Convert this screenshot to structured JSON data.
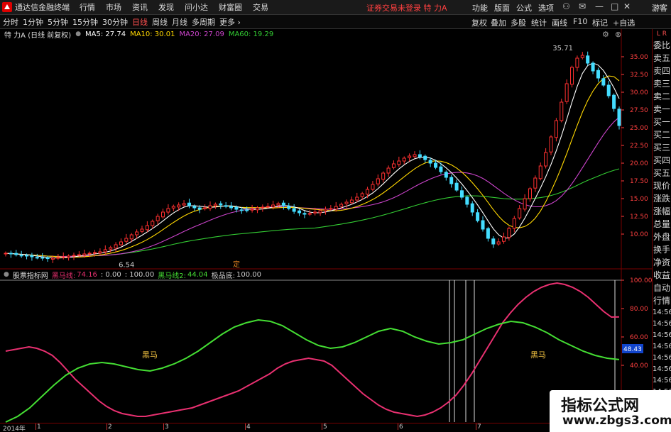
{
  "topbar": {
    "app_title": "通达信金融终端",
    "menus": [
      "行情",
      "市场",
      "资讯",
      "发现",
      "问小达",
      "财富圈",
      "交易"
    ],
    "login_status": "证券交易未登录",
    "stock_name": "特 力A",
    "right_menus": [
      "功能",
      "版面",
      "公式",
      "选项"
    ],
    "guest": "游客"
  },
  "toolbar": {
    "periods": [
      "分时",
      "1分钟",
      "5分钟",
      "15分钟",
      "30分钟",
      "日线",
      "周线",
      "月线",
      "多周期",
      "更多 ›"
    ],
    "active_period": "日线",
    "tools": [
      "复权",
      "叠加",
      "多股",
      "统计",
      "画线",
      "F10",
      "标记",
      "+自选"
    ]
  },
  "infobar": {
    "title": "特 力A (日线 前复权)",
    "ma5": "MA5: 27.74",
    "ma10": "MA10: 30.01",
    "ma20": "MA20: 27.09",
    "ma60": "MA60: 19.29"
  },
  "subinfo": {
    "indicator": "股票指标网",
    "line1_label": "黑马线:",
    "line1_value": "74.16",
    "zero": ": 0.00",
    "hundred": ": 100.00",
    "line2_label": "黑马线2:",
    "line2_value": "44.04",
    "bottom_label": "极品底:",
    "bottom_value": "100.00"
  },
  "annotations": {
    "high": "35.71",
    "low": "6.54",
    "marker_hm1": "黑马",
    "marker_hm2": "黑马",
    "marker_d": "定",
    "current_tag": "48.43"
  },
  "right_panel": {
    "top": "L R",
    "items": [
      "委比",
      "卖五",
      "卖四",
      "卖三",
      "卖二",
      "卖一",
      "买一",
      "买二",
      "买三",
      "买四",
      "买五",
      "现价",
      "涨跌",
      "涨幅",
      "总量",
      "外盘",
      "换手",
      "净资",
      "收益",
      "自动",
      "行情",
      "14:56",
      "14:56",
      "14:56",
      "14:56",
      "14:56",
      "14:56",
      "14:56",
      "14:56"
    ]
  },
  "bottom_axis": [
    "2014年",
    "1",
    "2",
    "3",
    "4",
    "5",
    "6",
    "7"
  ],
  "watermark": {
    "title": "指标公式网",
    "url": "www.zbgs3.com"
  },
  "colors": {
    "ma5": "#ffffff",
    "ma10": "#ffd700",
    "ma20": "#cc44cc",
    "ma60": "#33cc33",
    "up": "#ff3030",
    "down": "#44ddff",
    "line1": "#e83070",
    "line2": "#44dd33",
    "axis": "#ff4040"
  },
  "chart_data": [
    {
      "type": "candlestick",
      "y_axis_ticks": [
        "35.00",
        "32.50",
        "30.00",
        "27.50",
        "25.00",
        "22.50",
        "20.00",
        "17.50",
        "15.00",
        "12.50",
        "10.00"
      ],
      "ylim": [
        5.5,
        37.5
      ],
      "x_labels": [
        "2014年",
        "1",
        "2",
        "3",
        "4",
        "5",
        "6",
        "7"
      ],
      "close": [
        7.3,
        7.2,
        7.1,
        7.0,
        6.9,
        6.8,
        6.7,
        6.6,
        6.54,
        6.6,
        6.7,
        6.8,
        6.9,
        7.0,
        7.1,
        7.2,
        7.3,
        7.4,
        7.5,
        7.8,
        8.1,
        8.5,
        8.9,
        9.4,
        9.9,
        10.3,
        10.7,
        11.2,
        11.8,
        12.5,
        13.1,
        13.6,
        13.9,
        14.1,
        14.3,
        14.0,
        13.7,
        13.5,
        13.7,
        14.0,
        14.2,
        14.1,
        13.9,
        13.7,
        13.5,
        13.4,
        13.3,
        13.5,
        13.7,
        13.8,
        13.9,
        14.1,
        14.3,
        14.0,
        13.6,
        13.2,
        13.0,
        12.8,
        12.9,
        13.1,
        13.3,
        13.5,
        13.6,
        13.9,
        14.2,
        14.5,
        14.8,
        15.2,
        15.7,
        16.3,
        17.0,
        17.8,
        18.6,
        19.3,
        19.9,
        20.3,
        20.7,
        21.0,
        21.2,
        20.9,
        20.5,
        20.0,
        19.4,
        18.8,
        18.0,
        17.1,
        16.2,
        15.2,
        14.2,
        13.1,
        11.9,
        10.7,
        9.4,
        8.6,
        8.9,
        9.6,
        10.8,
        12.2,
        13.6,
        15.0,
        16.4,
        17.9,
        19.6,
        21.5,
        23.7,
        26.0,
        28.6,
        31.2,
        33.5,
        34.8,
        35.2,
        34.1,
        33.0,
        32.0,
        31.0,
        29.5,
        27.7,
        25.3
      ],
      "ma_current": {
        "MA5": 27.74,
        "MA10": 30.01,
        "MA20": 27.09,
        "MA60": 19.29
      },
      "high_marker": 35.71,
      "low_marker": 6.54
    },
    {
      "type": "line",
      "y_axis_ticks": [
        "100.00",
        "80.00",
        "60.00",
        "40.00",
        "20.00"
      ],
      "ylim": [
        0,
        100
      ],
      "series": [
        {
          "name": "黑马线",
          "values": [
            50,
            51,
            52,
            53,
            52,
            50,
            47,
            42,
            36,
            30,
            25,
            20,
            15,
            11,
            8,
            6,
            5,
            4,
            4,
            5,
            6,
            7,
            8,
            9,
            10,
            12,
            14,
            16,
            18,
            20,
            22,
            25,
            28,
            31,
            34,
            38,
            41,
            43,
            44,
            45,
            44,
            43,
            40,
            35,
            30,
            25,
            20,
            16,
            12,
            9,
            7,
            6,
            5,
            4,
            5,
            7,
            10,
            14,
            19,
            26,
            34,
            43,
            52,
            61,
            70,
            77,
            83,
            88,
            92,
            95,
            97,
            98,
            97,
            95,
            92,
            88,
            83,
            78,
            74,
            74.16
          ]
        },
        {
          "name": "黑马线2",
          "values": [
            0,
            4,
            10,
            18,
            26,
            33,
            38,
            41,
            42,
            41,
            39,
            37,
            36,
            38,
            41,
            45,
            50,
            56,
            62,
            67,
            70,
            72,
            71,
            68,
            63,
            58,
            54,
            52,
            53,
            56,
            60,
            64,
            66,
            64,
            60,
            57,
            55,
            56,
            58,
            62,
            66,
            69,
            71,
            70,
            67,
            63,
            58,
            54,
            50,
            47,
            45,
            44.04
          ]
        }
      ]
    }
  ]
}
